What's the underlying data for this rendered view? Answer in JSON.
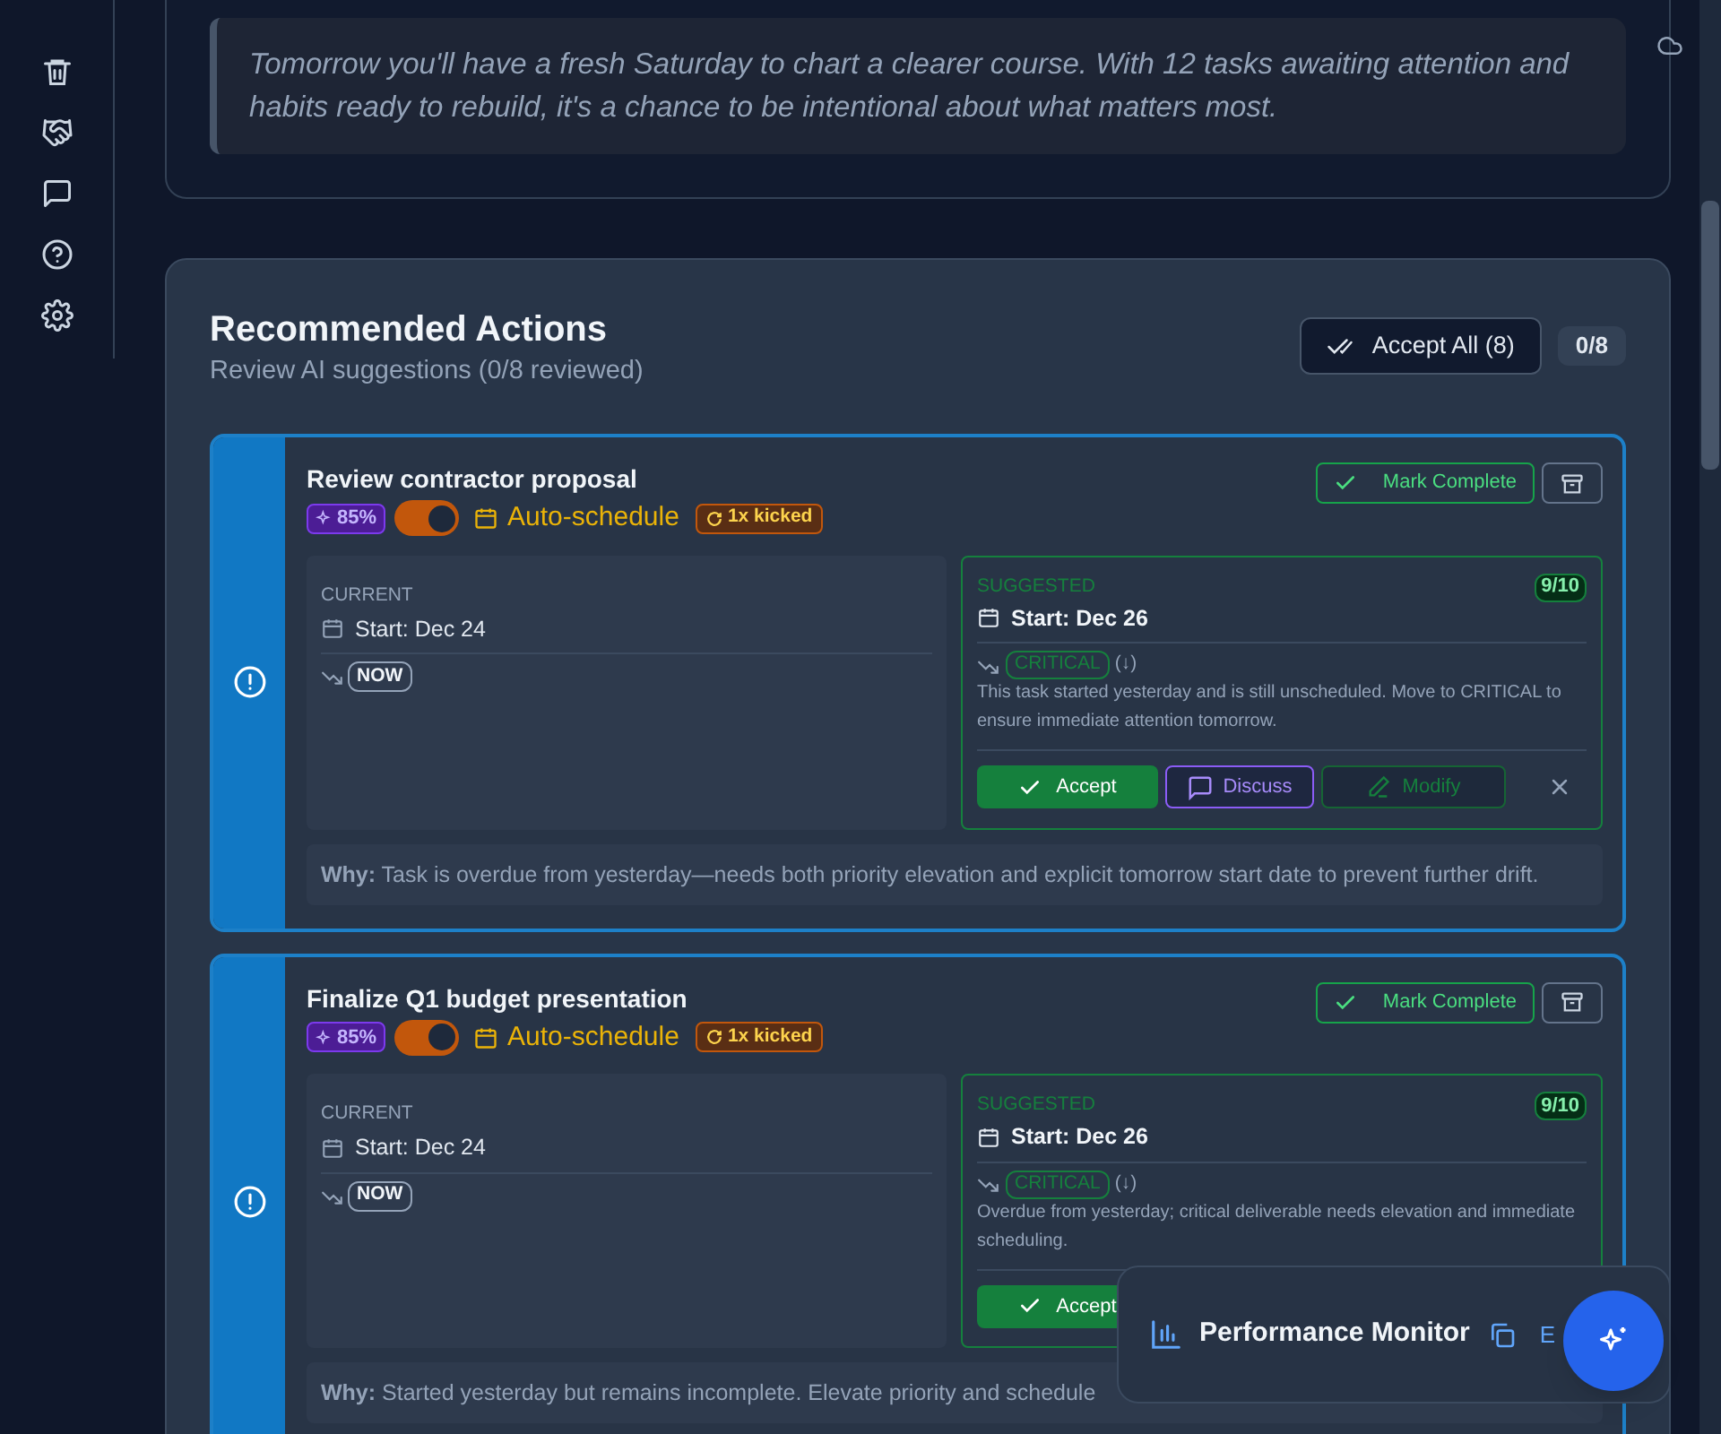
{
  "reflection": {
    "quote": "Tomorrow you'll have a fresh Saturday to chart a clearer course. With 12 tasks awaiting attention and habits ready to rebuild, it's a chance to be intentional about what matters most."
  },
  "recommended": {
    "title": "Recommended Actions",
    "subtitle": "Review AI suggestions (0/8 reviewed)",
    "accept_all": "Accept All (8)",
    "progress": "0/8"
  },
  "tasks": [
    {
      "title": "Review contractor proposal",
      "confidence": "85%",
      "auto_schedule": {
        "on": true,
        "label": "Auto-schedule"
      },
      "kicked": "1x kicked",
      "mark_complete": "Mark Complete",
      "current": {
        "label": "CURRENT",
        "start": "Start: Dec 24",
        "priority": "NOW"
      },
      "suggested": {
        "label": "SUGGESTED",
        "score": "9/10",
        "start": "Start: Dec 26",
        "priority": "CRITICAL",
        "direction": "(↓)",
        "reason": "This task started yesterday and is still unscheduled. Move to CRITICAL to ensure immediate attention tomorrow.",
        "actions": [
          {
            "kind": "accept",
            "label": "Accept"
          },
          {
            "kind": "discuss",
            "label": "Discuss"
          },
          {
            "kind": "modify",
            "label": "Modify"
          },
          {
            "kind": "dismiss"
          }
        ]
      },
      "why": "**Why:** Task is overdue from yesterday—needs both priority elevation and explicit tomorrow start date to prevent further drift."
    },
    {
      "title": "Finalize Q1 budget presentation",
      "confidence": "85%",
      "auto_schedule": {
        "on": true,
        "label": "Auto-schedule"
      },
      "kicked": "1x kicked",
      "mark_complete": "Mark Complete",
      "current": {
        "label": "CURRENT",
        "start": "Start: Dec 24",
        "priority": "NOW"
      },
      "suggested": {
        "label": "SUGGESTED",
        "score": "9/10",
        "start": "Start: Dec 26",
        "priority": "CRITICAL",
        "direction": "(↓)",
        "reason": "Overdue from yesterday; critical deliverable needs elevation and immediate scheduling.",
        "actions": [
          {
            "kind": "accept",
            "label": "Accept"
          }
        ]
      },
      "why": "**Why:** Started yesterday but remains incomplete. Elevate priority and schedule"
    }
  ],
  "performance_monitor": {
    "title": "Performance Monitor",
    "action": "E"
  }
}
